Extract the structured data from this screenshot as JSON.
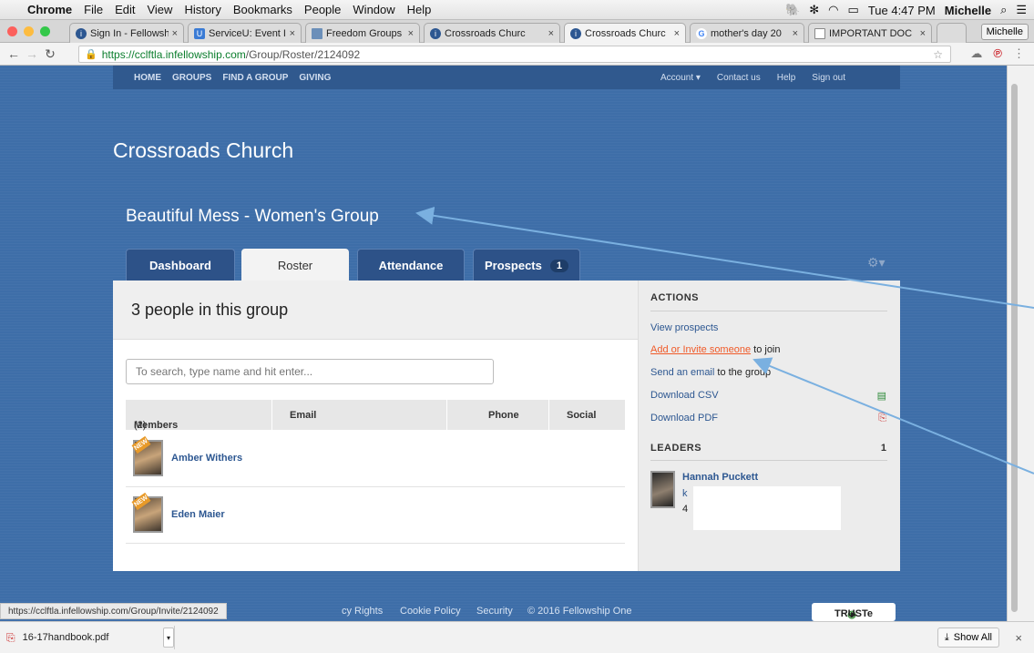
{
  "mac_menu": {
    "app": "Chrome",
    "items": [
      "File",
      "Edit",
      "View",
      "History",
      "Bookmarks",
      "People",
      "Window",
      "Help"
    ],
    "clock": "Tue 4:47 PM",
    "user": "Michelle"
  },
  "browser": {
    "tabs": [
      {
        "label": "Sign In - Fellowsh",
        "icon": "fellowship-one-icon",
        "color": "#2d5791"
      },
      {
        "label": "ServiceU: Event I",
        "icon": "serviceu-icon",
        "color": "#3a7bd5"
      },
      {
        "label": "Freedom Groups",
        "icon": "document-icon",
        "color": "#6b8fb9"
      },
      {
        "label": "Crossroads Churc",
        "icon": "fellowship-one-icon",
        "color": "#2d5791"
      },
      {
        "label": "Crossroads Churc",
        "icon": "fellowship-one-icon",
        "color": "#2d5791"
      },
      {
        "label": "mother's day 20",
        "icon": "google-icon",
        "color": "#4285f4"
      },
      {
        "label": "IMPORTANT DOC",
        "icon": "document-icon",
        "color": "#888888"
      }
    ],
    "profile": "Michelle",
    "url_host": "https://cclftla.infellowship.com",
    "url_path": "/Group/Roster/2124092",
    "status_url": "https://cclftla.infellowship.com/Group/Invite/2124092"
  },
  "site": {
    "nav_left": [
      "HOME",
      "GROUPS",
      "FIND A GROUP",
      "GIVING"
    ],
    "nav_right": [
      "Account ▾",
      "Contact us",
      "Help",
      "Sign out"
    ],
    "church_name": "Crossroads Church",
    "group_name": "Beautiful Mess - Women's Group"
  },
  "group_tabs": {
    "dashboard": "Dashboard",
    "roster": "Roster",
    "attendance": "Attendance",
    "prospects": "Prospects",
    "prospects_count": "1"
  },
  "roster": {
    "count_text": "3 people in this group",
    "search_placeholder": "To search, type name and hit enter...",
    "col_members": "Members",
    "members_count": "(2)",
    "col_email": "Email",
    "col_phone": "Phone",
    "col_social": "Social",
    "members": [
      {
        "name": "Amber Withers",
        "badge": "NEW"
      },
      {
        "name": "Eden Maier",
        "badge": "NEW"
      }
    ]
  },
  "actions": {
    "heading": "ACTIONS",
    "view_prospects": "View prospects",
    "add_invite": "Add or Invite someone",
    "add_invite_suffix": "to join",
    "send_email": "Send an email",
    "send_email_suffix": "to the group",
    "download_csv": "Download CSV",
    "download_pdf": "Download PDF"
  },
  "leaders": {
    "heading": "LEADERS",
    "count": "1",
    "name": "Hannah Puckett",
    "line1": "k",
    "line2": "4"
  },
  "footer": {
    "privacy": "cy Rights",
    "cookie": "Cookie Policy",
    "security": "Security",
    "copyright": "© 2016 Fellowship One",
    "truste": "TRUSTe"
  },
  "downloads": {
    "file": "16-17handbook.pdf",
    "show_all": "Show All"
  }
}
